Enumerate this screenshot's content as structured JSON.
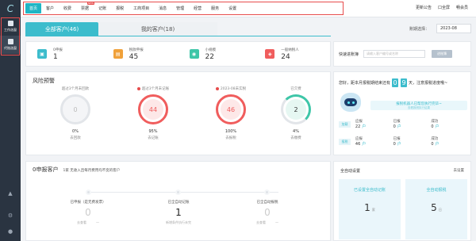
{
  "sidebar": {
    "logo": "C",
    "items": [
      {
        "label": "工作选窗"
      },
      {
        "label": "代账选窗"
      }
    ]
  },
  "nav": {
    "items": [
      "首页",
      "客户",
      "收费",
      "票据",
      "记账",
      "报税",
      "工商项目",
      "消息",
      "管理",
      "经营",
      "服务",
      "设置"
    ],
    "new_badge": "NEW"
  },
  "top_right": {
    "announce": "更新公告",
    "fullscreen": "口全屏",
    "member": "畅会员"
  },
  "tabs": {
    "all": "全部客户(46)",
    "mine": "我的客户(18)"
  },
  "period": {
    "label": "账期选择：",
    "value": "2023-08"
  },
  "stats": [
    {
      "label": "0申报",
      "value": "1",
      "color": "#3cbccc"
    },
    {
      "label": "税款申报",
      "value": "45",
      "color": "#f0a13a"
    },
    {
      "label": "小规模",
      "value": "22",
      "color": "#3ec6a8"
    },
    {
      "label": "一般纳税人",
      "value": "24",
      "color": "#f05d5d"
    }
  ],
  "quick": {
    "label": "快速进账簿",
    "placeholder": "请输入客户编号或名称",
    "button": "进账簿"
  },
  "warning": {
    "title": "风险预警",
    "gauges": [
      {
        "title": "超过3个月未回款",
        "value": "0",
        "pct": "0%",
        "link": "去回款",
        "color": "#cfd4da",
        "text_color": "#bbb",
        "alert": false
      },
      {
        "title": "超过3个月未记账",
        "value": "44",
        "pct": "95%",
        "link": "去记账",
        "color": "#f05d5d",
        "text_color": "#f05d5d",
        "alert": true
      },
      {
        "title": "2023-08未实税",
        "value": "46",
        "pct": "100%",
        "link": "去报税",
        "color": "#f05d5d",
        "text_color": "#f05d5d",
        "alert": true
      },
      {
        "title": "已欠费",
        "value": "2",
        "pct": "4%",
        "link": "去缴费",
        "color": "#3ec6a8",
        "text_color": "#333",
        "alert": false
      }
    ]
  },
  "deadline": {
    "prefix": "您好，距本月报税期结束还有",
    "d1": "0",
    "d2": "9",
    "suffix": "天，注意报税进度哦~",
    "bubble_main": "报税机器人已帮您执行完毕~",
    "bubble_sub": "查看报税执行结果",
    "rows": [
      {
        "tag": "加载",
        "c1k": "应报",
        "c1v": "22",
        "c2k": "已报",
        "c2v": "0",
        "c3k": "成功",
        "c3v": "0"
      },
      {
        "tag": "报税",
        "c1k": "应报",
        "c1v": "46",
        "c2k": "已报",
        "c2v": "0",
        "c3k": "成功",
        "c3v": "0"
      }
    ],
    "unit_link": "户"
  },
  "zero_section": {
    "title": "0申报客户",
    "subtitle": "1家 无收入且每月费用均不变的客户",
    "steps": [
      {
        "label": "已申报（是无费发票）",
        "value": "0",
        "dark": false,
        "extra": [
          "去查看",
          "一"
        ]
      },
      {
        "label": "已全自动记账",
        "value": "1",
        "dark": true,
        "extra": [
          "新增条件执行未完"
        ]
      },
      {
        "label": "已全自动报税",
        "value": "0",
        "dark": false,
        "extra": [
          "去查看",
          "一"
        ]
      }
    ]
  },
  "auto": {
    "title": "全自动设置",
    "link": "去设置",
    "boxes": [
      {
        "title": "已设置全自动记账",
        "value": "1",
        "unit": "家"
      },
      {
        "title": "全自动报税",
        "value": "5",
        "unit": "日"
      }
    ]
  }
}
